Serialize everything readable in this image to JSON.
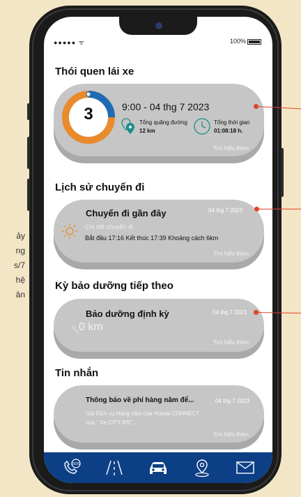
{
  "left_text": [
    "ảy",
    "ng",
    "s/7",
    "hệ",
    "ân"
  ],
  "status": {
    "signal": "●●●●● ᯤ",
    "battery": "100%"
  },
  "habits": {
    "title": "Thói quen lái xe",
    "score": "3",
    "datetime": "9:00 - 04 thg 7 2023",
    "distance_label": "Tổng quãng đường",
    "distance_value": "12 km",
    "time_label": "Tổng thời gian",
    "time_value": "01:08:18 h.",
    "more": "Tìm hiểu thêm"
  },
  "trips": {
    "title": "Lịch sử chuyến đi",
    "card_title": "Chuyến đi gần đây",
    "date": "04 thg 7 2023",
    "detail_label": "Chi tiết chuyến đi",
    "detail": "Bắt đầu 17:16 Kết thúc 17:39 Khoảng cách 6km",
    "more": "Tìm hiểu thêm"
  },
  "maintenance": {
    "title": "Kỳ bảo dưỡng tiếp theo",
    "card_title": "Bảo dưỡng định kỳ",
    "date": "04 thg 7 2023",
    "value": "0 km",
    "more": "Tìm hiểu thêm"
  },
  "messages": {
    "title": "Tin nhắn",
    "card_title": "Thông báo về phí hàng năm để...",
    "date": "04 thg 7 2023",
    "body_line1": "Gói Dịch vụ Hàng năm của Honda CONNECT",
    "body_line2": "của \" Xe CITY RS\"...",
    "more": "Tìm hiểu thêm"
  },
  "nav": {
    "items": [
      {
        "icon": "sos-phone-icon"
      },
      {
        "icon": "road-icon"
      },
      {
        "icon": "car-icon"
      },
      {
        "icon": "location-pin-icon"
      },
      {
        "icon": "mail-icon"
      }
    ]
  },
  "colors": {
    "accent_orange": "#e98a2c",
    "accent_blue": "#1f6cb5",
    "teal": "#1c8c8c",
    "nav_blue": "#0d3f86",
    "indicator_red": "#e0442a"
  }
}
